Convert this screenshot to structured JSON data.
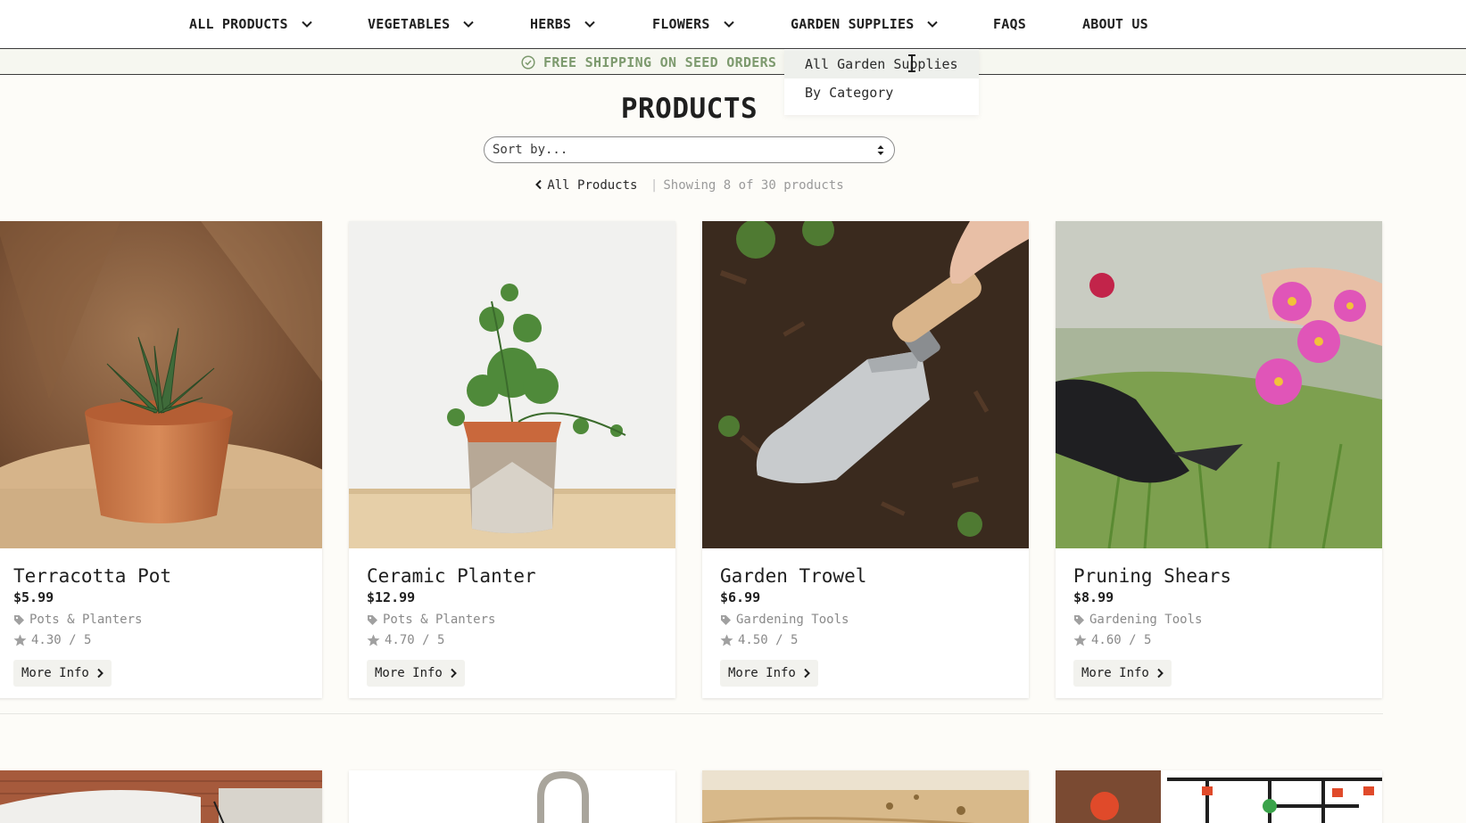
{
  "nav": {
    "items": [
      {
        "label": "ALL PRODUCTS",
        "dropdown": true
      },
      {
        "label": "VEGETABLES",
        "dropdown": true
      },
      {
        "label": "HERBS",
        "dropdown": true
      },
      {
        "label": "FLOWERS",
        "dropdown": true
      },
      {
        "label": "GARDEN SUPPLIES",
        "dropdown": true
      },
      {
        "label": "FAQS",
        "dropdown": false
      },
      {
        "label": "ABOUT US",
        "dropdown": false
      }
    ],
    "open_dropdown": {
      "parent": "GARDEN SUPPLIES",
      "items": [
        "All Garden Supplies",
        "By Category"
      ],
      "hovered_index": 0
    }
  },
  "banner": {
    "text": "FREE SHIPPING ON SEED ORDERS O",
    "icon": "check-circle-icon",
    "color": "#7d9a6e"
  },
  "page": {
    "title": "PRODUCTS",
    "sort_placeholder": "Sort by...",
    "back_label": "All Products",
    "separator": "|",
    "count_text": "Showing 8 of 30 products"
  },
  "products": [
    {
      "name": "Terracotta Pot",
      "price": "$5.99",
      "category": "Pots & Planters",
      "rating": "4.30 / 5",
      "button": "More Info",
      "image": "terracotta-pot-photo"
    },
    {
      "name": "Ceramic Planter",
      "price": "$12.99",
      "category": "Pots & Planters",
      "rating": "4.70 / 5",
      "button": "More Info",
      "image": "ceramic-planter-photo"
    },
    {
      "name": "Garden Trowel",
      "price": "$6.99",
      "category": "Gardening Tools",
      "rating": "4.50 / 5",
      "button": "More Info",
      "image": "garden-trowel-photo"
    },
    {
      "name": "Pruning Shears",
      "price": "$8.99",
      "category": "Gardening Tools",
      "rating": "4.60 / 5",
      "button": "More Info",
      "image": "pruning-shears-photo"
    }
  ],
  "next_row_images": [
    "garage-door-photo",
    "faucet-photo",
    "wooden-table-photo",
    "drip-irrigation-photo"
  ],
  "colors": {
    "background": "#fdfcf8",
    "banner_bg": "#f6f7f0",
    "text": "#1f1f1f",
    "muted": "#8a8a8a",
    "accent_green": "#7d9a6e"
  }
}
